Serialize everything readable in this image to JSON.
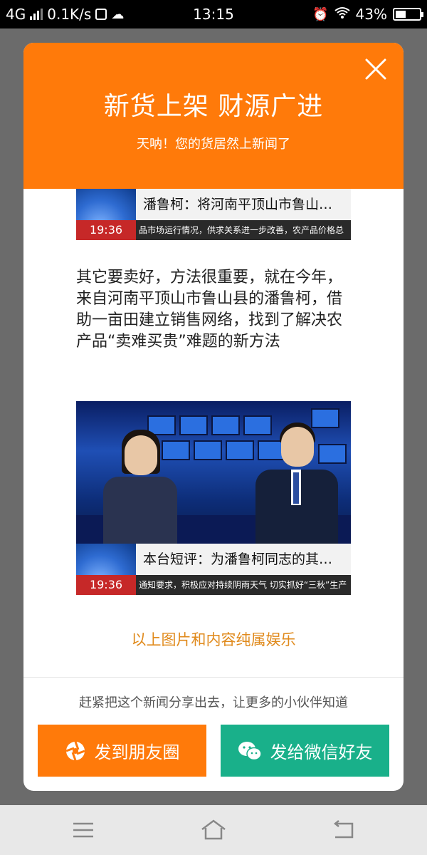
{
  "status_bar": {
    "network": "4G",
    "speed": "0.1K/s",
    "time": "13:15",
    "battery": "43%",
    "battery_level": 0.43
  },
  "background_page": {
    "left_glyph": "×"
  },
  "modal": {
    "title": "新货上架 财源广进",
    "subtitle": "天呐！您的货居然上新闻了",
    "close_icon": "close-icon",
    "accent_color": "#ff7a0a"
  },
  "news_cards": [
    {
      "title": "潘鲁柯：将河南平顶山市鲁山…",
      "time": "19:36",
      "ticker": "品市场运行情况，供求关系进一步改善，农产品价格总"
    },
    {
      "title": "本台短评：为潘鲁柯同志的其…",
      "time": "19:36",
      "ticker": "通知要求，积极应对持续阴雨天气 切实抓好“三秋”生产"
    }
  ],
  "article": {
    "text": "其它要卖好，方法很重要，就在今年，来自河南平顶山市鲁山县的潘鲁柯，借助一亩田建立销售网络，找到了解决农产品“卖难买贵”难题的新方法"
  },
  "disclaimer": "以上图片和内容纯属娱乐",
  "share": {
    "prompt": "赶紧把这个新闻分享出去，让更多的小伙伴知道",
    "moments_label": "发到朋友圈",
    "wechat_label": "发给微信好友",
    "moments_color": "#ff7a0a",
    "wechat_color": "#19b08a"
  },
  "nav_bar": {
    "items": [
      "menu-icon",
      "home-icon",
      "back-icon"
    ]
  }
}
